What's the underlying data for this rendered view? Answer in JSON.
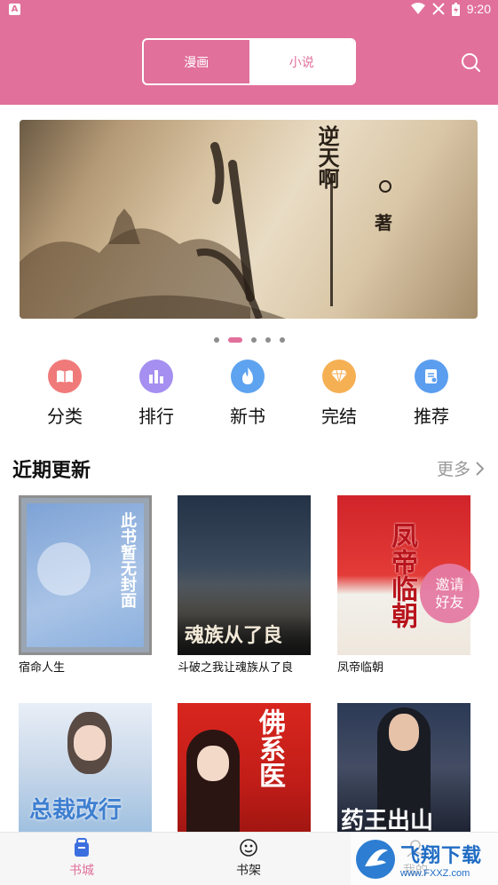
{
  "status_bar": {
    "time": "9:20",
    "left_badge": "A"
  },
  "header": {
    "tabs": [
      {
        "label": "漫画"
      },
      {
        "label": "小说"
      }
    ],
    "selected_tab": "小说"
  },
  "banner": {
    "title_text": "逆天啊",
    "author_suffix": "著",
    "slide_count": 5,
    "active_slide": 2
  },
  "quick_links": [
    {
      "label": "分类",
      "icon": "book-icon",
      "color": "#f07a7a"
    },
    {
      "label": "排行",
      "icon": "bar-chart-icon",
      "color": "#a58ff0"
    },
    {
      "label": "新书",
      "icon": "flame-icon",
      "color": "#5ea3f0"
    },
    {
      "label": "完结",
      "icon": "diamond-icon",
      "color": "#f5b054"
    },
    {
      "label": "推荐",
      "icon": "document-icon",
      "color": "#5b9ef0"
    }
  ],
  "recent": {
    "title": "近期更新",
    "more_label": "更多",
    "books": [
      {
        "title": "宿命人生",
        "cover_text": "此书暂无封面"
      },
      {
        "title": "斗破之我让魂族从了良",
        "cover_text": "魂族从了良"
      },
      {
        "title": "凤帝临朝",
        "cover_text": "凤帝临朝"
      },
      {
        "title": "",
        "cover_text": "总裁改行"
      },
      {
        "title": "",
        "cover_text": "佛系医"
      },
      {
        "title": "",
        "cover_text": "药王出山"
      }
    ]
  },
  "invite_button": {
    "label": "邀请好友"
  },
  "tab_bar": {
    "items": [
      {
        "label": "书城"
      },
      {
        "label": "书架"
      },
      {
        "label": "我的"
      }
    ],
    "active": "书城"
  },
  "watermark": {
    "cn": "飞翔下载",
    "en": "www.FXXZ.com"
  }
}
